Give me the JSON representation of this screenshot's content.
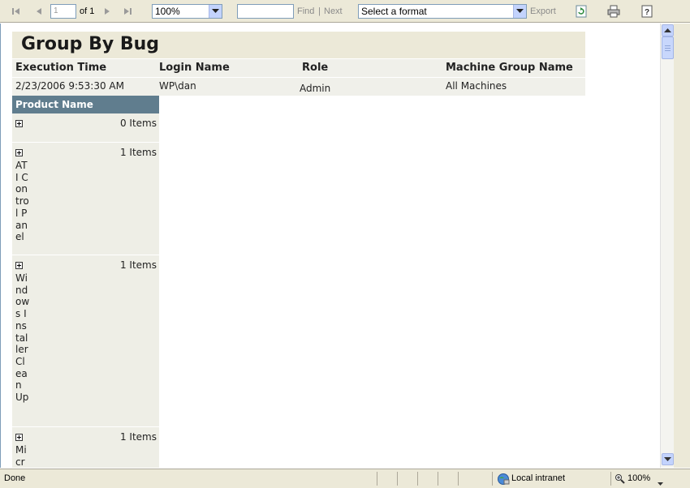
{
  "toolbar": {
    "page_number": "1",
    "of_label": "of 1",
    "zoom_value": "100%",
    "find_value": "",
    "find_label": "Find",
    "separator": "|",
    "next_label": "Next",
    "format_value": "Select a format",
    "export_label": "Export",
    "icons": [
      "first-page-icon",
      "previous-page-icon",
      "next-page-icon",
      "last-page-icon",
      "refresh-icon",
      "print-icon",
      "help-icon"
    ]
  },
  "report": {
    "title": "Group By Bug",
    "headers": [
      "Execution Time",
      "Login Name",
      "Role",
      "Machine Group Name"
    ],
    "values": [
      "2/23/2006 9:53:30 AM",
      "WP\\dan",
      "Admin",
      "All Machines"
    ],
    "product_header": "Product Name",
    "groups": [
      {
        "name": "",
        "count": "0 Items"
      },
      {
        "name": "ATI Control Panel",
        "count": "1 Items"
      },
      {
        "name": "Windows Installer Clean Up",
        "count": "1 Items"
      },
      {
        "name": "Micr",
        "count": "1 Items"
      }
    ]
  },
  "status": {
    "text": "Done",
    "zone": "Local intranet",
    "zoom": "100%"
  },
  "colors": {
    "product_header_bg": "#607d8e",
    "title_bg": "#ece9d8",
    "chrome": "#ece9d8"
  }
}
